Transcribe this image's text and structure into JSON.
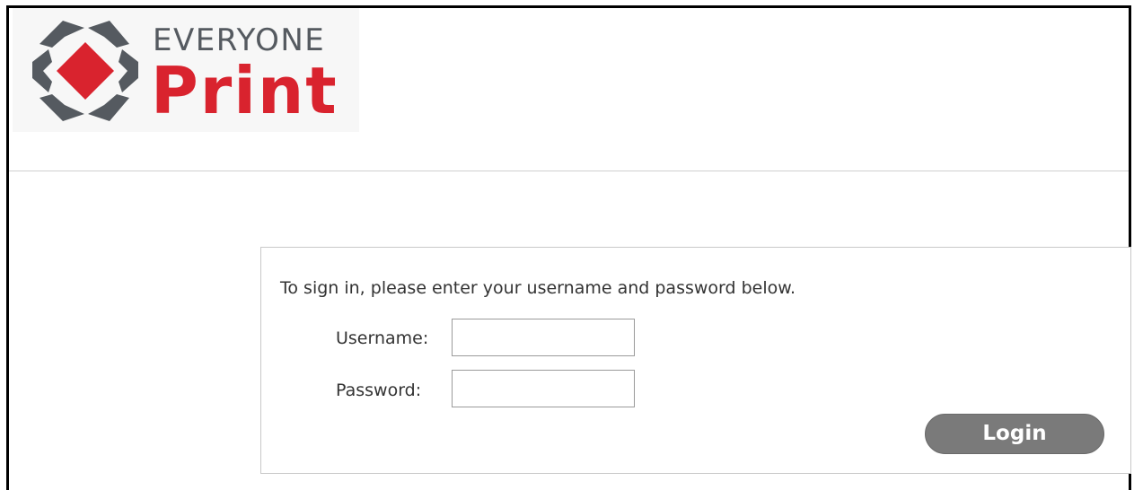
{
  "logo": {
    "line1": "EVERYONE",
    "line2": "Print",
    "colors": {
      "gray": "#555a60",
      "red": "#d9232e"
    }
  },
  "login": {
    "instructions": "To sign in, please enter your username and password below.",
    "username_label": "Username:",
    "password_label": "Password:",
    "username_value": "",
    "password_value": "",
    "button_label": "Login"
  },
  "colors": {
    "button_bg": "#7a7a7a",
    "border": "#c8c8c8"
  }
}
